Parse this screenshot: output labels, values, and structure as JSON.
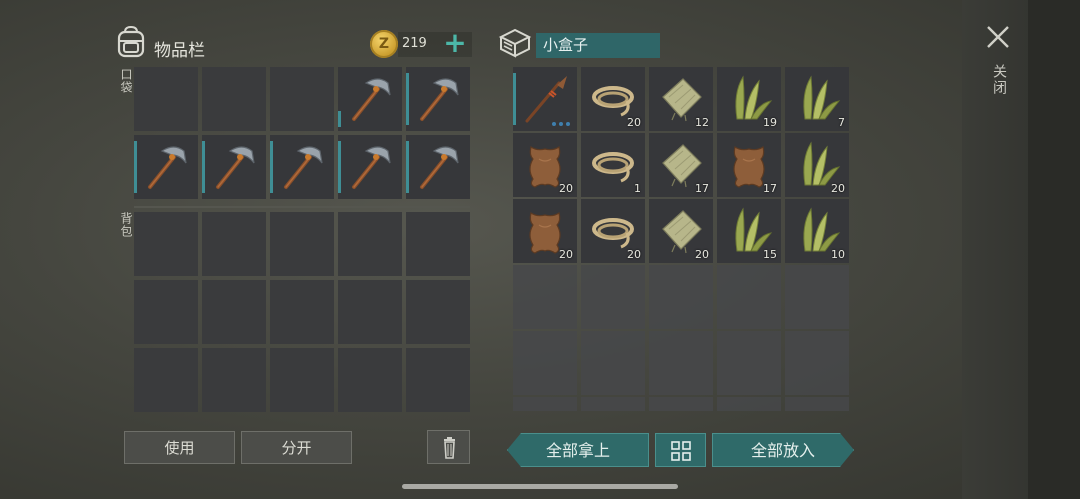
{
  "inventory": {
    "title": "物品栏",
    "coins": "219",
    "pocket_label": "口袋",
    "backpack_label": "背包",
    "pocket_slots": [
      {
        "item": "",
        "qty": ""
      },
      {
        "item": "",
        "qty": ""
      },
      {
        "item": "",
        "qty": ""
      },
      {
        "item": "pickaxe",
        "qty": ""
      },
      {
        "item": "pickaxe",
        "qty": ""
      },
      {
        "item": "pickaxe",
        "qty": ""
      },
      {
        "item": "pickaxe",
        "qty": ""
      },
      {
        "item": "pickaxe",
        "qty": ""
      },
      {
        "item": "pickaxe",
        "qty": ""
      },
      {
        "item": "pickaxe",
        "qty": ""
      }
    ],
    "backpack_slots": 15
  },
  "container": {
    "name": "小盒子",
    "slots": [
      {
        "item": "spear",
        "qty": ""
      },
      {
        "item": "rope",
        "qty": "20"
      },
      {
        "item": "cloth",
        "qty": "12"
      },
      {
        "item": "plant",
        "qty": "19"
      },
      {
        "item": "plant",
        "qty": "7"
      },
      {
        "item": "leather",
        "qty": "20"
      },
      {
        "item": "rope",
        "qty": "1"
      },
      {
        "item": "cloth",
        "qty": "17"
      },
      {
        "item": "leather",
        "qty": "17"
      },
      {
        "item": "plant",
        "qty": "20"
      },
      {
        "item": "leather",
        "qty": "20"
      },
      {
        "item": "rope",
        "qty": "20"
      },
      {
        "item": "cloth",
        "qty": "20"
      },
      {
        "item": "plant",
        "qty": "15"
      },
      {
        "item": "plant",
        "qty": "10"
      }
    ]
  },
  "buttons": {
    "use": "使用",
    "split": "分开",
    "take_all": "全部拿上",
    "put_all": "全部放入",
    "close": "关闭"
  },
  "colors": {
    "accent": "#3f8e95",
    "teal_button": "#2f6a69",
    "plus": "#4cb7a8",
    "coin": "#e0b847"
  }
}
